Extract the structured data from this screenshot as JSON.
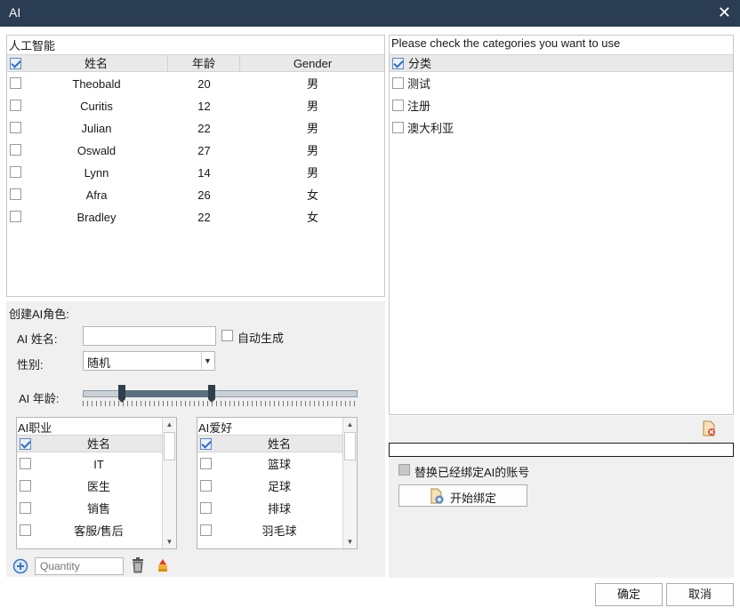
{
  "window": {
    "title": "AI",
    "close_glyph": "✕"
  },
  "ai_list": {
    "caption": "人工智能",
    "columns": [
      "姓名",
      "年龄",
      "Gender"
    ],
    "rows": [
      {
        "name": "Theobald",
        "age": "20",
        "gender": "男"
      },
      {
        "name": "Curitis",
        "age": "12",
        "gender": "男"
      },
      {
        "name": "Julian",
        "age": "22",
        "gender": "男"
      },
      {
        "name": "Oswald",
        "age": "27",
        "gender": "男"
      },
      {
        "name": "Lynn",
        "age": "14",
        "gender": "男"
      },
      {
        "name": "Afra",
        "age": "26",
        "gender": "女"
      },
      {
        "name": "Bradley",
        "age": "22",
        "gender": "女"
      }
    ]
  },
  "categories": {
    "caption": "Please check the categories you want to use",
    "column": "分类",
    "items": [
      "测试",
      "注册",
      "澳大利亚"
    ]
  },
  "create": {
    "section_label": "创建AI角色:",
    "name_label": "AI 姓名:",
    "name_value": "",
    "auto_generate_label": "自动生成",
    "gender_label": "性别:",
    "gender_value": "随机",
    "age_label": "AI 年龄:",
    "age_range": {
      "min": 12,
      "max": 40
    }
  },
  "job_list": {
    "caption": "AI职业",
    "column": "姓名",
    "items": [
      "IT",
      "医生",
      "销售",
      "客服/售后"
    ]
  },
  "hobby_list": {
    "caption": "AI爱好",
    "column": "姓名",
    "items": [
      "篮球",
      "足球",
      "排球",
      "羽毛球"
    ]
  },
  "toolbar": {
    "quantity_placeholder": "Quantity"
  },
  "binding": {
    "replace_label": "替换已经绑定AI的账号",
    "start_label": "开始绑定"
  },
  "footer": {
    "ok_label": "确定",
    "cancel_label": "取消"
  }
}
